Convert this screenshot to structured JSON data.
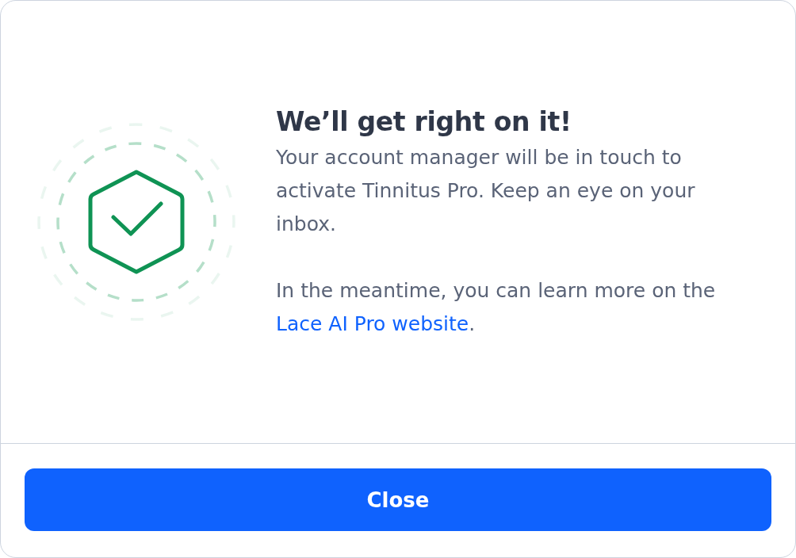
{
  "dialog": {
    "title": "We’ll get right on it!",
    "paragraphs": [
      {
        "text": "Your account manager will be in touch to activate Tinnitus Pro. Keep an eye on your inbox."
      },
      {
        "text": "In the meantime, you can learn more on the",
        "link": "Lace AI Pro website",
        "after": "."
      }
    ]
  },
  "footer": {
    "button": "Close"
  }
}
